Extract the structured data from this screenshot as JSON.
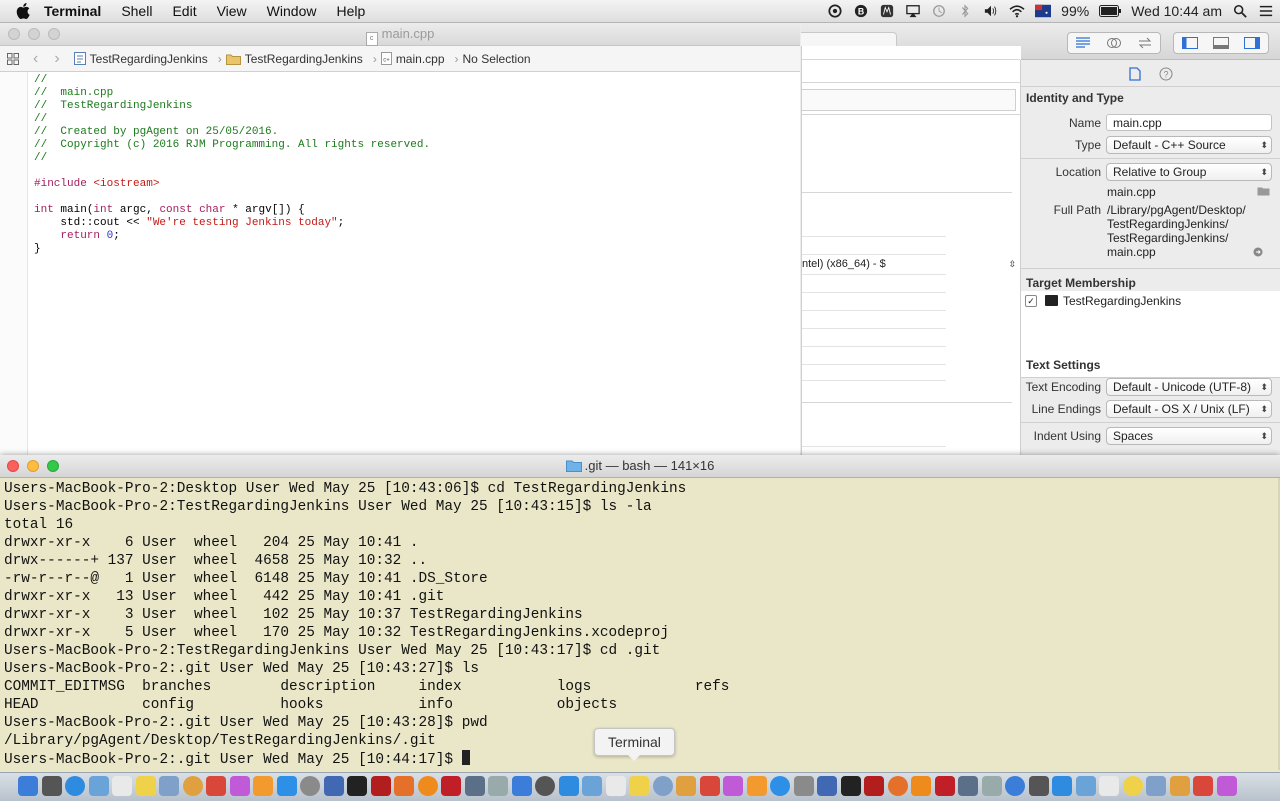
{
  "menubar": {
    "app_name": "Terminal",
    "items": [
      "Shell",
      "Edit",
      "View",
      "Window",
      "Help"
    ],
    "battery": "99%",
    "clock": "Wed 10:44 am"
  },
  "xcode": {
    "title": "main.cpp",
    "breadcrumbs": [
      "TestRegardingJenkins",
      "TestRegardingJenkins",
      "main.cpp",
      "No Selection"
    ],
    "code_lines": [
      {
        "t": "//",
        "c": "cm"
      },
      {
        "t": "//  main.cpp",
        "c": "cm"
      },
      {
        "t": "//  TestRegardingJenkins",
        "c": "cm"
      },
      {
        "t": "//",
        "c": "cm"
      },
      {
        "t": "//  Created by pgAgent on 25/05/2016.",
        "c": "cm"
      },
      {
        "t": "//  Copyright (c) 2016 RJM Programming. All rights reserved.",
        "c": "cm"
      },
      {
        "t": "//",
        "c": "cm"
      },
      {
        "t": "",
        "c": ""
      },
      {
        "t": "#include <iostream>",
        "c": "inc"
      },
      {
        "t": "",
        "c": ""
      },
      {
        "t": "int main(int argc, const char * argv[]) {",
        "c": "fn"
      },
      {
        "t": "    std::cout << \"We're testing Jenkins today\";",
        "c": "out"
      },
      {
        "t": "    return 0;",
        "c": "ret"
      },
      {
        "t": "}",
        "c": ""
      }
    ],
    "mid_pane_text": "ntel) (x86_64)  -  $"
  },
  "inspector": {
    "identity_header": "Identity and Type",
    "name_label": "Name",
    "name_value": "main.cpp",
    "type_label": "Type",
    "type_value": "Default - C++ Source",
    "location_label": "Location",
    "location_value": "Relative to Group",
    "location_file": "main.cpp",
    "fullpath_label": "Full Path",
    "fullpath_lines": [
      "/Library/pgAgent/Desktop/",
      "TestRegardingJenkins/",
      "TestRegardingJenkins/",
      "main.cpp"
    ],
    "target_header": "Target Membership",
    "target_item": "TestRegardingJenkins",
    "text_header": "Text Settings",
    "encoding_label": "Text Encoding",
    "encoding_value": "Default - Unicode (UTF-8)",
    "lineend_label": "Line Endings",
    "lineend_value": "Default - OS X / Unix (LF)",
    "indent_label": "Indent Using",
    "indent_value": "Spaces"
  },
  "terminal": {
    "title": ".git — bash — 141×16",
    "lines": [
      "Users-MacBook-Pro-2:Desktop User Wed May 25 [10:43:06]$ cd TestRegardingJenkins",
      "Users-MacBook-Pro-2:TestRegardingJenkins User Wed May 25 [10:43:15]$ ls -la",
      "total 16",
      "drwxr-xr-x    6 User  wheel   204 25 May 10:41 .",
      "drwx------+ 137 User  wheel  4658 25 May 10:32 ..",
      "-rw-r--r--@   1 User  wheel  6148 25 May 10:41 .DS_Store",
      "drwxr-xr-x   13 User  wheel   442 25 May 10:41 .git",
      "drwxr-xr-x    3 User  wheel   102 25 May 10:37 TestRegardingJenkins",
      "drwxr-xr-x    5 User  wheel   170 25 May 10:32 TestRegardingJenkins.xcodeproj",
      "Users-MacBook-Pro-2:TestRegardingJenkins User Wed May 25 [10:43:17]$ cd .git",
      "Users-MacBook-Pro-2:.git User Wed May 25 [10:43:27]$ ls",
      "COMMIT_EDITMSG  branches        description     index           logs            refs",
      "HEAD            config          hooks           info            objects",
      "Users-MacBook-Pro-2:.git User Wed May 25 [10:43:28]$ pwd",
      "/Library/pgAgent/Desktop/TestRegardingJenkins/.git",
      "Users-MacBook-Pro-2:.git User Wed May 25 [10:44:17]$ "
    ],
    "tooltip": "Terminal"
  },
  "colors": {
    "terminal_bg": "#eae7c8",
    "comment": "#1c7a1c",
    "keyword": "#a3205f",
    "string": "#c41a16"
  }
}
